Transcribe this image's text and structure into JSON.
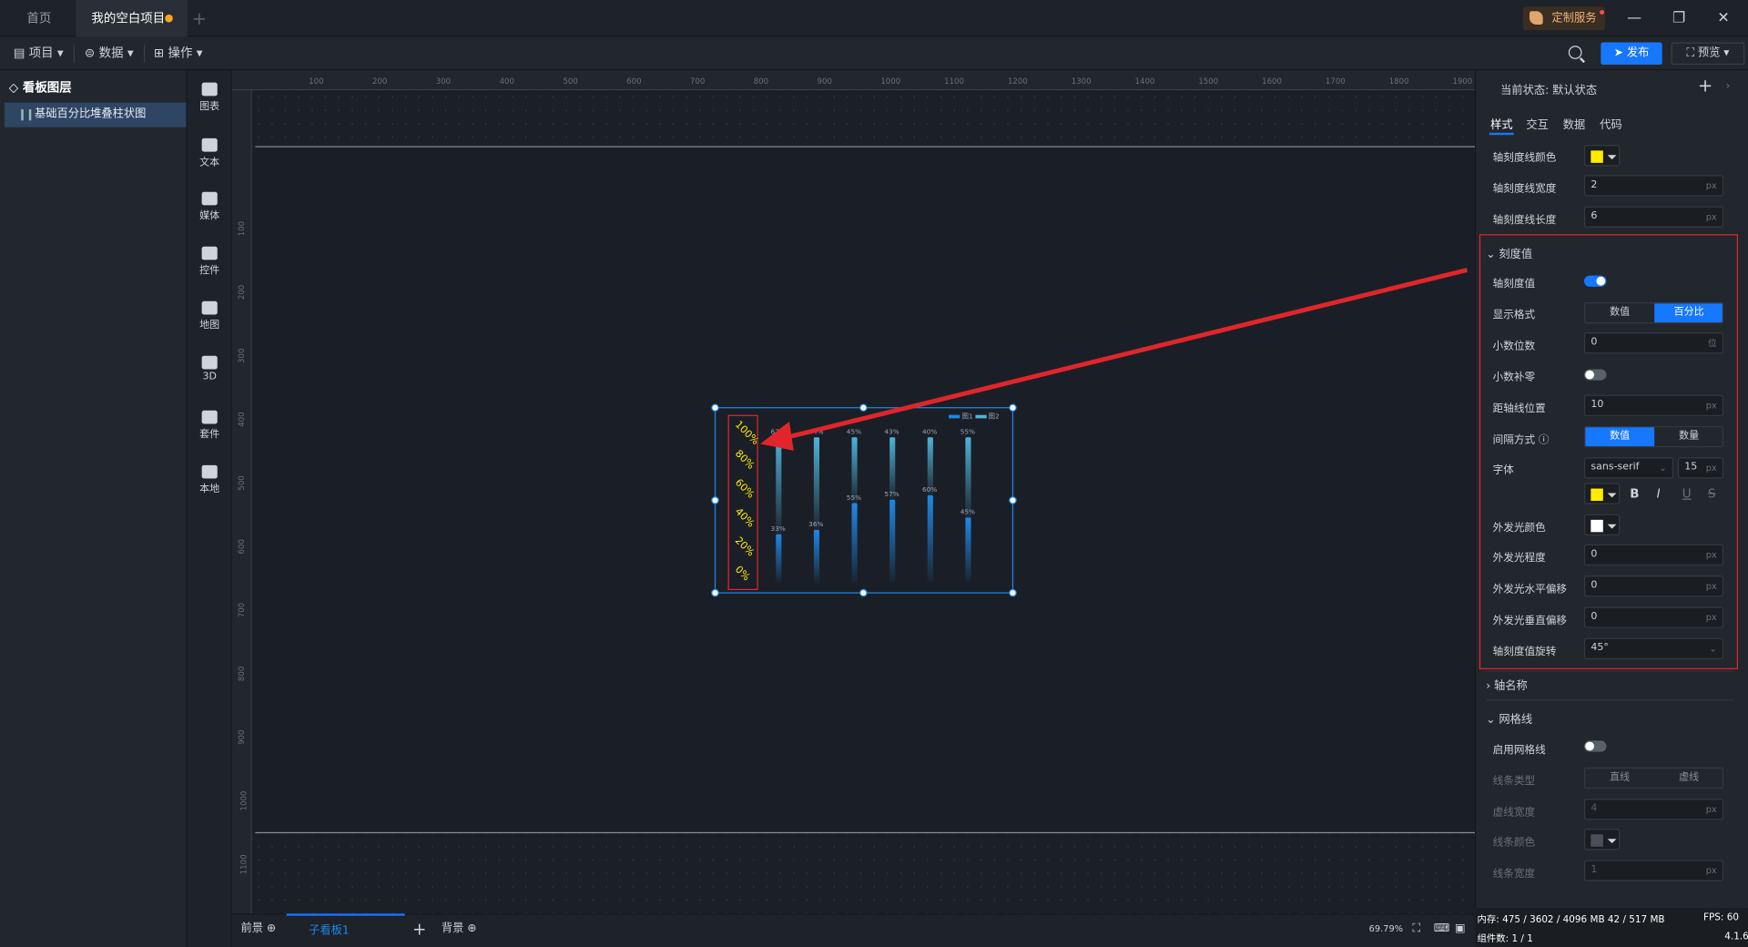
{
  "tabs": [
    {
      "label": "首页"
    },
    {
      "label": "我的空白项目"
    }
  ],
  "custom_service": "定制服务",
  "window": {
    "minimize": "—",
    "restore": "❐",
    "close": "✕"
  },
  "toolbar": {
    "project": "项目",
    "data": "数据",
    "ops": "操作",
    "publish": "发布",
    "preview": "预览"
  },
  "layers": {
    "title": "看板图层",
    "item": "基础百分比堆叠柱状图"
  },
  "components": [
    "图表",
    "文本",
    "媒体",
    "控件",
    "地图",
    "3D",
    "套件",
    "本地"
  ],
  "ruler": {
    "h": [
      "100",
      "200",
      "300",
      "400",
      "500",
      "600",
      "700",
      "800",
      "900",
      "1000",
      "1100",
      "1200",
      "1300",
      "1400",
      "1500",
      "1600",
      "1700",
      "1800",
      "1900"
    ],
    "v": [
      "100",
      "200",
      "300",
      "400",
      "500",
      "600",
      "700",
      "800",
      "900",
      "1000",
      "1100"
    ]
  },
  "chart_data": {
    "type": "bar",
    "legend": [
      "图1",
      "图2"
    ],
    "y_ticks": [
      "100%",
      "80%",
      "60%",
      "40%",
      "20%",
      "0%"
    ],
    "top_labels": [
      "67%",
      "64%",
      "45%",
      "43%",
      "40%",
      "55%"
    ],
    "bottom_labels": [
      "33%",
      "36%",
      "55%",
      "57%",
      "60%",
      "45%"
    ],
    "series": [
      {
        "name": "图1",
        "values": [
          33,
          36,
          55,
          57,
          60,
          45
        ]
      },
      {
        "name": "图2",
        "values": [
          67,
          64,
          45,
          43,
          40,
          55
        ]
      }
    ],
    "colors": {
      "s1": "#1e88e5",
      "s2": "#4fb3d9",
      "axis_label": "#ffeb00"
    }
  },
  "panel": {
    "state_label": "当前状态: 默认状态",
    "tabs": [
      "样式",
      "交互",
      "数据",
      "代码"
    ],
    "tick_line_color_label": "轴刻度线颜色",
    "tick_line_width_label": "轴刻度线宽度",
    "tick_line_width": "2",
    "tick_line_length_label": "轴刻度线长度",
    "tick_line_length": "6",
    "tick_value_section": "刻度值",
    "tick_value_label": "轴刻度值",
    "format_label": "显示格式",
    "format_opts": [
      "数值",
      "百分比"
    ],
    "decimals_label": "小数位数",
    "decimals": "0",
    "decimals_unit": "位",
    "zero_pad_label": "小数补零",
    "distance_label": "距轴线位置",
    "distance": "10",
    "interval_label": "间隔方式",
    "interval_opts": [
      "数值",
      "数量"
    ],
    "font_label": "字体",
    "font_family": "sans-serif",
    "font_size": "15",
    "glow_color_label": "外发光颜色",
    "glow_level_label": "外发光程度",
    "glow_level": "0",
    "glow_h_label": "外发光水平偏移",
    "glow_h": "0",
    "glow_v_label": "外发光垂直偏移",
    "glow_v": "0",
    "rotate_label": "轴刻度值旋转",
    "rotate": "45°",
    "axis_name_section": "轴名称",
    "grid_section": "网格线",
    "grid_enable_label": "启用网格线",
    "line_type_label": "线条类型",
    "line_type_opts": [
      "直线",
      "虚线"
    ],
    "dash_width_label": "虚线宽度",
    "dash_width": "4",
    "line_color_label": "线条颜色",
    "line_width_label": "线条宽度",
    "line_width": "1",
    "unit_px": "px"
  },
  "bottom": {
    "front": "前景",
    "sub": "子看板1",
    "back": "背景",
    "zoom": "69.79%"
  },
  "status": {
    "mem": "内存:  475 / 3602 / 4096 MB  42 / 517 MB",
    "fps": "FPS:  60",
    "count": "组件数: 1 / 1",
    "ver": "4.1.6"
  }
}
